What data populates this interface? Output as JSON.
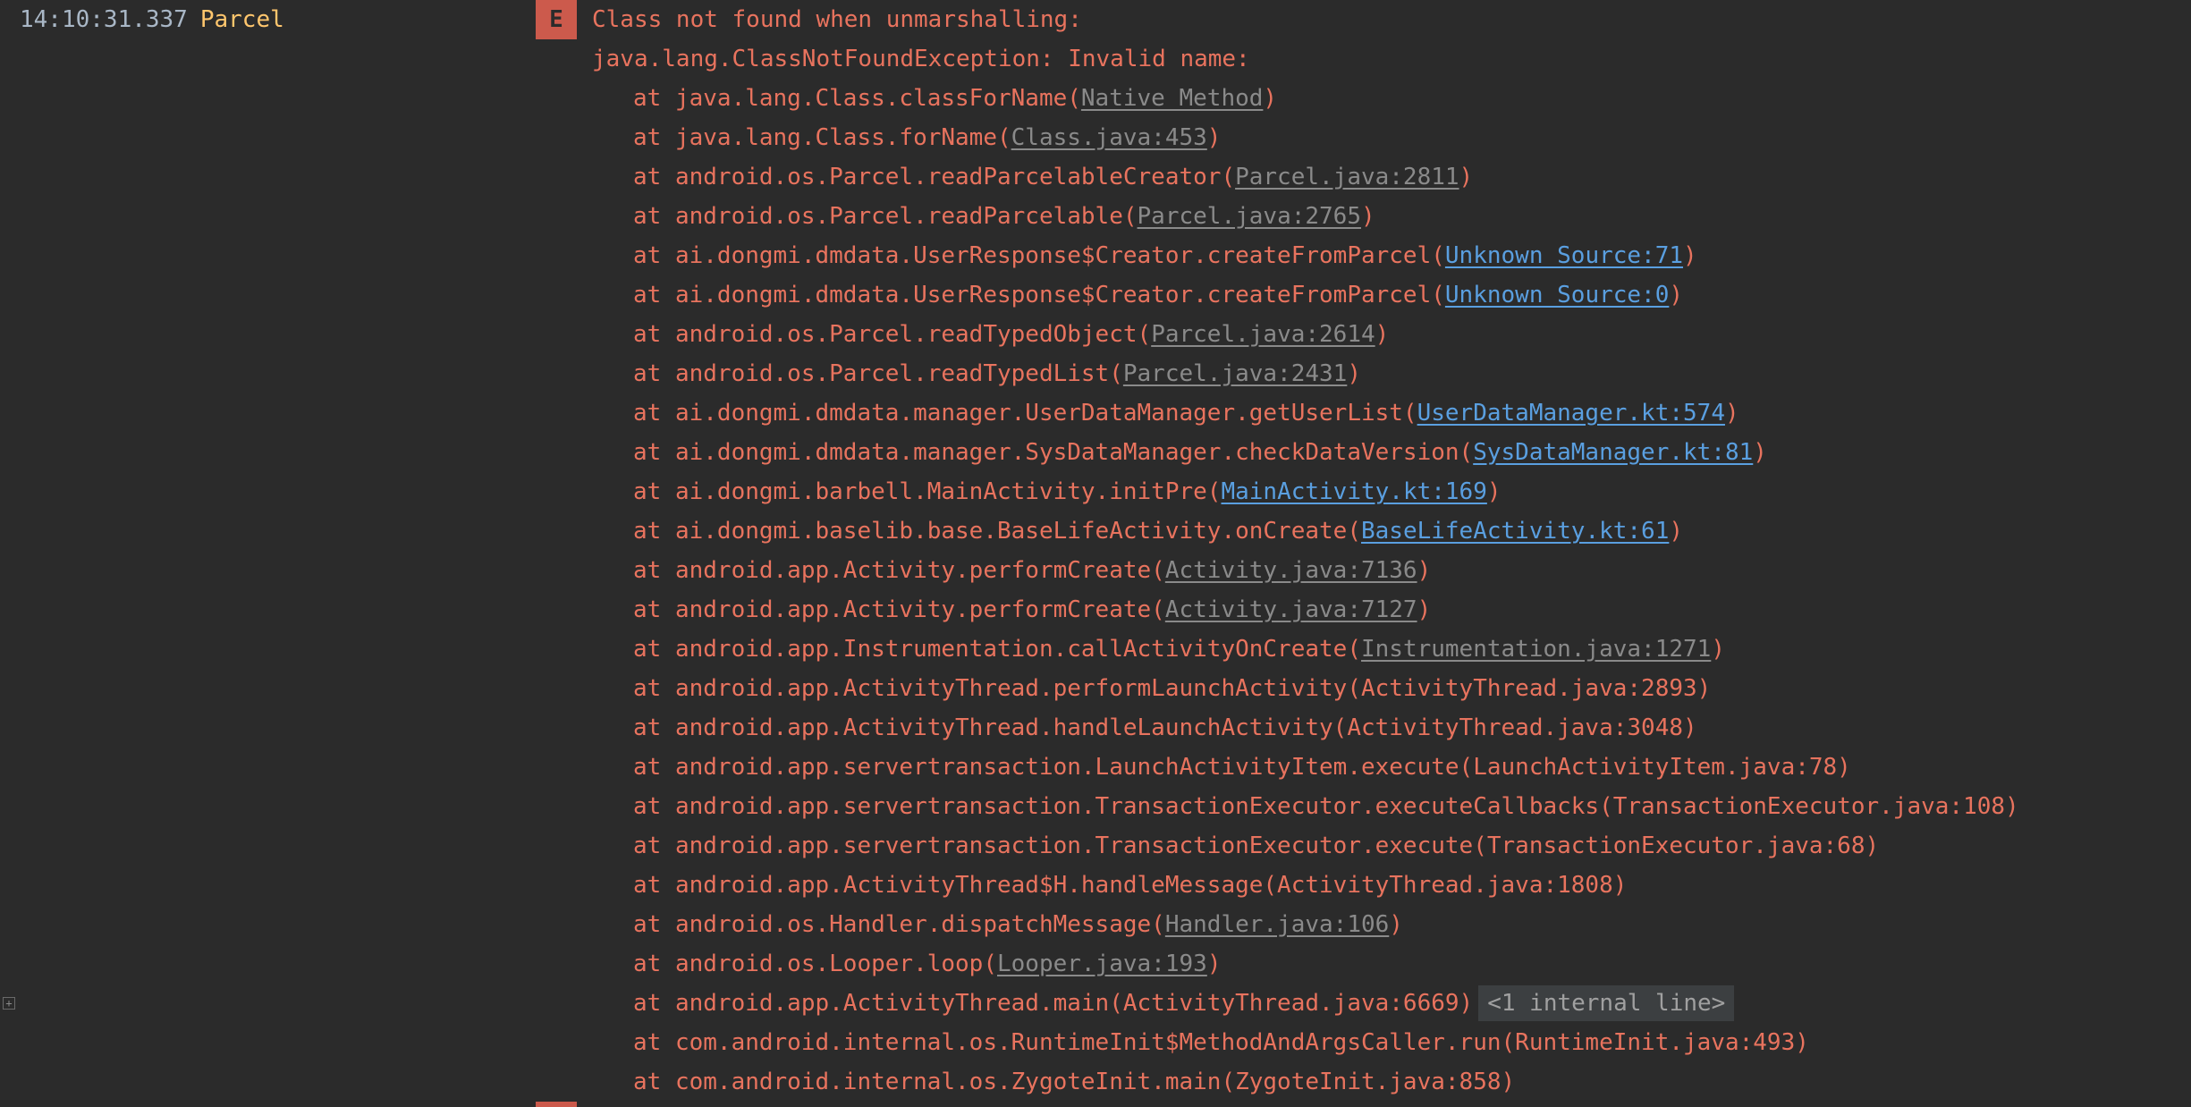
{
  "log": {
    "timestamp": "14:10:31.337",
    "tag": "Parcel",
    "level": "E",
    "message": "Class not found when unmarshalling:",
    "exception": "java.lang.ClassNotFoundException: Invalid name:",
    "fold_label": "<1 internal line>",
    "colors": {
      "background": "#2b2b2b",
      "error_text": "#e8735e",
      "timestamp": "#a9b7c6",
      "tag": "#ffc66d",
      "badge": "#cc5a4c",
      "link_library": "#8a8a8a",
      "link_project": "#5a9fe0"
    },
    "frames": [
      {
        "text": "at java.lang.Class.classForName(",
        "link": "Native Method",
        "link_type": "gray",
        "suffix": ")"
      },
      {
        "text": "at java.lang.Class.forName(",
        "link": "Class.java:453",
        "link_type": "gray",
        "suffix": ")"
      },
      {
        "text": "at android.os.Parcel.readParcelableCreator(",
        "link": "Parcel.java:2811",
        "link_type": "gray",
        "suffix": ")"
      },
      {
        "text": "at android.os.Parcel.readParcelable(",
        "link": "Parcel.java:2765",
        "link_type": "gray",
        "suffix": ")"
      },
      {
        "text": "at ai.dongmi.dmdata.UserResponse$Creator.createFromParcel(",
        "link": "Unknown Source:71",
        "link_type": "blue",
        "suffix": ")"
      },
      {
        "text": "at ai.dongmi.dmdata.UserResponse$Creator.createFromParcel(",
        "link": "Unknown Source:0",
        "link_type": "blue",
        "suffix": ")"
      },
      {
        "text": "at android.os.Parcel.readTypedObject(",
        "link": "Parcel.java:2614",
        "link_type": "gray",
        "suffix": ")"
      },
      {
        "text": "at android.os.Parcel.readTypedList(",
        "link": "Parcel.java:2431",
        "link_type": "gray",
        "suffix": ")"
      },
      {
        "text": "at ai.dongmi.dmdata.manager.UserDataManager.getUserList(",
        "link": "UserDataManager.kt:574",
        "link_type": "blue",
        "suffix": ")"
      },
      {
        "text": "at ai.dongmi.dmdata.manager.SysDataManager.checkDataVersion(",
        "link": "SysDataManager.kt:81",
        "link_type": "blue",
        "suffix": ")"
      },
      {
        "text": "at ai.dongmi.barbell.MainActivity.initPre(",
        "link": "MainActivity.kt:169",
        "link_type": "blue",
        "suffix": ")"
      },
      {
        "text": "at ai.dongmi.baselib.base.BaseLifeActivity.onCreate(",
        "link": "BaseLifeActivity.kt:61",
        "link_type": "blue",
        "suffix": ")"
      },
      {
        "text": "at android.app.Activity.performCreate(",
        "link": "Activity.java:7136",
        "link_type": "gray",
        "suffix": ")"
      },
      {
        "text": "at android.app.Activity.performCreate(",
        "link": "Activity.java:7127",
        "link_type": "gray",
        "suffix": ")"
      },
      {
        "text": "at android.app.Instrumentation.callActivityOnCreate(",
        "link": "Instrumentation.java:1271",
        "link_type": "gray",
        "suffix": ")"
      },
      {
        "text": "at android.app.ActivityThread.performLaunchActivity(ActivityThread.java:2893)",
        "link": "",
        "link_type": "none",
        "suffix": ""
      },
      {
        "text": "at android.app.ActivityThread.handleLaunchActivity(ActivityThread.java:3048)",
        "link": "",
        "link_type": "none",
        "suffix": ""
      },
      {
        "text": "at android.app.servertransaction.LaunchActivityItem.execute(LaunchActivityItem.java:78)",
        "link": "",
        "link_type": "none",
        "suffix": ""
      },
      {
        "text": "at android.app.servertransaction.TransactionExecutor.executeCallbacks(TransactionExecutor.java:108)",
        "link": "",
        "link_type": "none",
        "suffix": ""
      },
      {
        "text": "at android.app.servertransaction.TransactionExecutor.execute(TransactionExecutor.java:68)",
        "link": "",
        "link_type": "none",
        "suffix": ""
      },
      {
        "text": "at android.app.ActivityThread$H.handleMessage(ActivityThread.java:1808)",
        "link": "",
        "link_type": "none",
        "suffix": ""
      },
      {
        "text": "at android.os.Handler.dispatchMessage(",
        "link": "Handler.java:106",
        "link_type": "gray",
        "suffix": ")"
      },
      {
        "text": "at android.os.Looper.loop(",
        "link": "Looper.java:193",
        "link_type": "gray",
        "suffix": ")"
      },
      {
        "text": "at android.app.ActivityThread.main(ActivityThread.java:6669)",
        "link": "",
        "link_type": "none",
        "suffix": "",
        "fold": true
      },
      {
        "text": "at com.android.internal.os.RuntimeInit$MethodAndArgsCaller.run(RuntimeInit.java:493)",
        "link": "",
        "link_type": "none",
        "suffix": ""
      },
      {
        "text": "at com.android.internal.os.ZygoteInit.main(ZygoteInit.java:858)",
        "link": "",
        "link_type": "none",
        "suffix": ""
      }
    ]
  }
}
